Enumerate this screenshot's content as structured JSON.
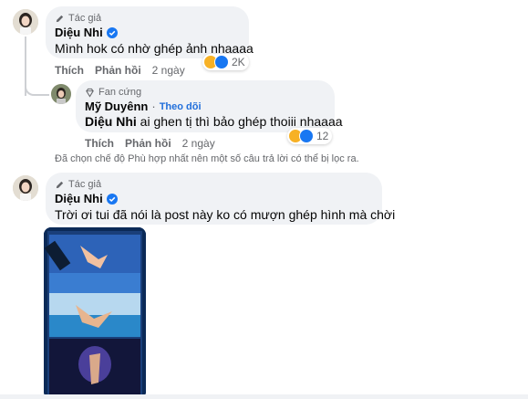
{
  "comment1": {
    "badge": "Tác giả",
    "name": "Diệu Nhi",
    "text": "Mình hok có nhờ ghép ảnh nhaaaa",
    "actions": {
      "like": "Thích",
      "reply": "Phản hồi",
      "time": "2 ngày"
    },
    "reaction_count": "2K"
  },
  "reply1": {
    "badge": "Fan cứng",
    "name": "Mỹ Duyênn",
    "follow": "Theo dõi",
    "mention": "Diệu Nhi",
    "text": " ai ghen tị thì bảo ghép thoiii nhaaaa",
    "actions": {
      "like": "Thích",
      "reply": "Phản hồi",
      "time": "2 ngày"
    },
    "reaction_count": "12"
  },
  "filter_notice": "Đã chọn chế độ Phù hợp nhất nên một số câu trả lời có thể bị lọc ra.",
  "comment2": {
    "badge": "Tác giả",
    "name": "Diệu Nhi",
    "text": "Trời ơi tui đã nói là post này ko có mượn ghép hình mà chời"
  },
  "colors": {
    "verified": "#1877f2",
    "bubble": "#f0f2f5",
    "link": "#216fdb",
    "meta": "#65676b"
  },
  "icons": [
    "pencil-icon",
    "verified-badge-icon",
    "diamond-icon",
    "haha-emoji-icon",
    "like-emoji-icon"
  ]
}
